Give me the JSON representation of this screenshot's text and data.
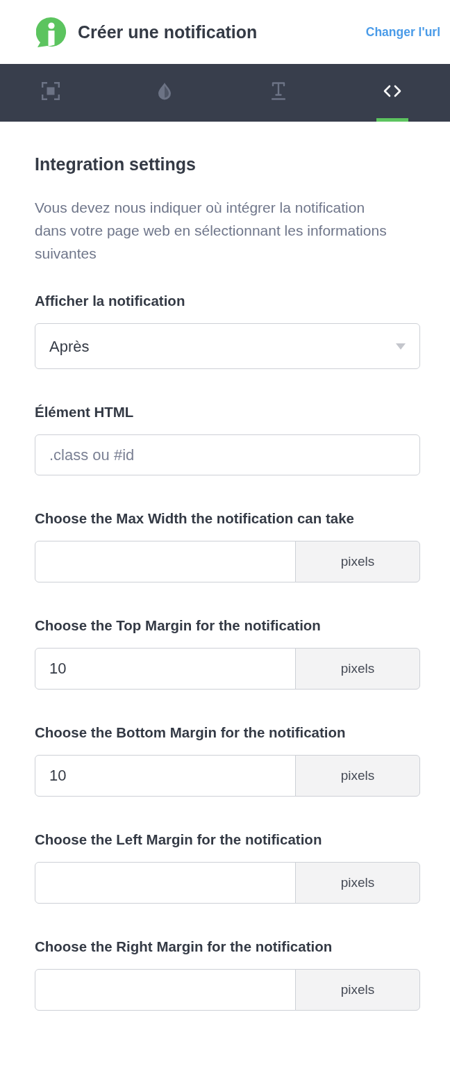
{
  "header": {
    "title": "Créer une notification",
    "link": "Changer l'url"
  },
  "tabs": [
    {
      "kind": "frame",
      "selected": false
    },
    {
      "kind": "drop",
      "selected": false
    },
    {
      "kind": "text",
      "selected": false
    },
    {
      "kind": "code",
      "selected": true
    }
  ],
  "section": {
    "title": "Integration settings",
    "description": "Vous devez nous indiquer où intégrer la notification dans votre page web en sélectionnant les informations suivantes"
  },
  "fields": [
    {
      "kind": "select",
      "label": "Afficher la notification",
      "value": "Après"
    },
    {
      "kind": "text",
      "label": "Élément HTML",
      "placeholder": ".class ou #id"
    },
    {
      "kind": "unit",
      "label": "Choose the Max Width the notification can take",
      "unit": "pixels"
    },
    {
      "kind": "unit",
      "label": "Choose the Top Margin for the notification",
      "value": "10",
      "unit": "pixels"
    },
    {
      "kind": "unit",
      "label": "Choose the Bottom Margin for the notification",
      "value": "10",
      "unit": "pixels"
    },
    {
      "kind": "unit",
      "label": "Choose the Left Margin for the notification",
      "unit": "pixels"
    },
    {
      "kind": "unit",
      "label": "Choose the Right Margin for the notification",
      "unit": "pixels"
    }
  ]
}
